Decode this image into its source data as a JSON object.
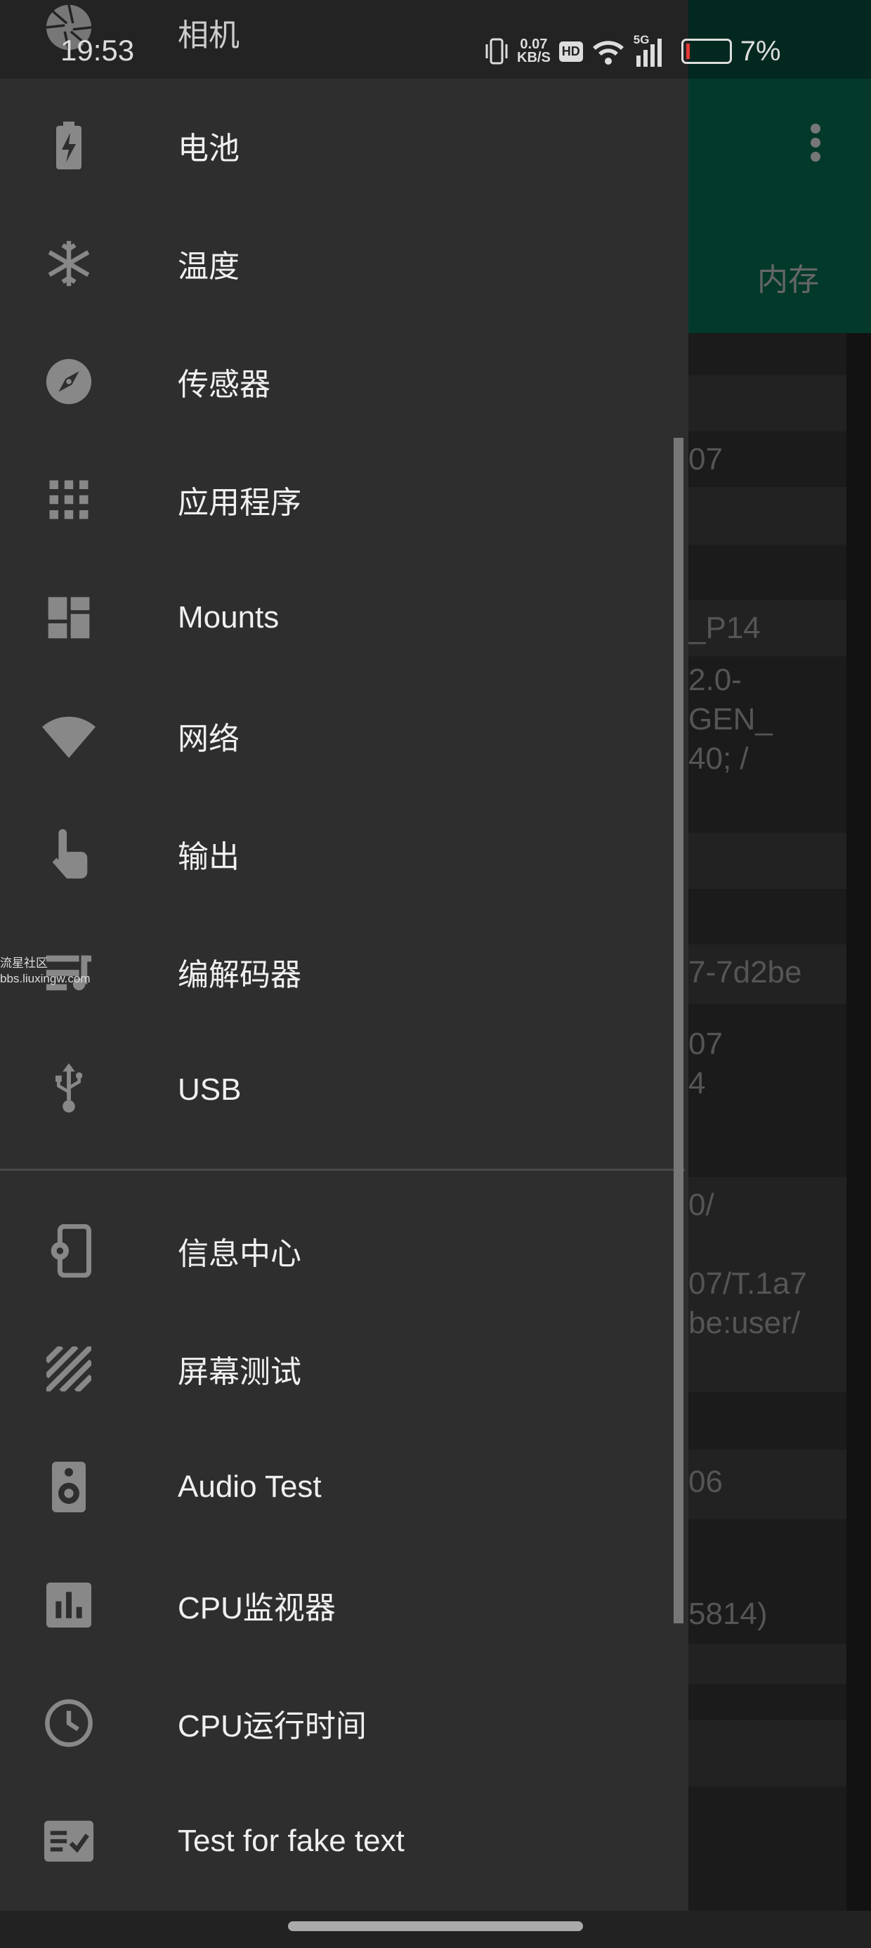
{
  "status_bar": {
    "time": "19:53",
    "notification_app": "相机",
    "net_speed": "0.07",
    "net_unit": "KB/S",
    "hd": "HD",
    "signal": "5G",
    "battery": "7%",
    "battery_color": "#e53935"
  },
  "app_bar": {
    "tab": "内存",
    "more_icon": "more-vert-icon",
    "color": "#03392b"
  },
  "background_rows": [
    "",
    "",
    "07",
    "",
    "",
    "_P14",
    "2.0-\nGEN_\n40; /",
    "",
    "",
    "7-7d2be",
    "07\n4",
    "0/\n\n07/T.1a7\nbe:user/",
    "",
    "06",
    "",
    "5814)",
    "",
    "",
    "",
    ""
  ],
  "drawer": {
    "group1": [
      {
        "label": "电池",
        "icon": "battery-icon"
      },
      {
        "label": "温度",
        "icon": "snowflake-icon"
      },
      {
        "label": "传感器",
        "icon": "compass-icon"
      },
      {
        "label": "应用程序",
        "icon": "apps-grid-icon"
      },
      {
        "label": "Mounts",
        "icon": "dashboard-icon"
      },
      {
        "label": "网络",
        "icon": "wifi-icon"
      },
      {
        "label": "输出",
        "icon": "touch-icon"
      },
      {
        "label": "编解码器",
        "icon": "codec-icon"
      },
      {
        "label": "USB",
        "icon": "usb-icon"
      }
    ],
    "group2": [
      {
        "label": "信息中心",
        "icon": "device-settings-icon"
      },
      {
        "label": "屏幕测试",
        "icon": "stripes-icon"
      },
      {
        "label": "Audio Test",
        "icon": "speaker-icon"
      },
      {
        "label": "CPU监视器",
        "icon": "bar-chart-icon"
      },
      {
        "label": "CPU运行时间",
        "icon": "clock-icon"
      },
      {
        "label": "Test for fake text",
        "icon": "checklist-icon"
      }
    ]
  },
  "watermark": {
    "line1": "流星社区",
    "line2": "bbs.liuxingw.com"
  }
}
